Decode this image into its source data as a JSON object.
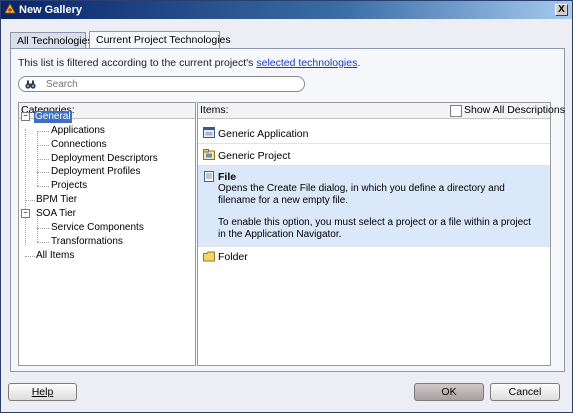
{
  "window": {
    "title": "New Gallery",
    "close_label": "X"
  },
  "tabs": [
    {
      "label": "All Technologies",
      "active": false
    },
    {
      "label": "Current Project Technologies",
      "active": true
    }
  ],
  "filter": {
    "text": "This list is filtered according to the current project's",
    "link": "selected technologies",
    "suffix": "."
  },
  "search": {
    "placeholder": "Search"
  },
  "categories": {
    "header": "Categories:",
    "tree": [
      {
        "label": "General",
        "selected": true,
        "expanded": true
      },
      {
        "label": "Applications"
      },
      {
        "label": "Connections"
      },
      {
        "label": "Deployment Descriptors"
      },
      {
        "label": "Deployment Profiles"
      },
      {
        "label": "Projects"
      },
      {
        "label": "BPM Tier"
      },
      {
        "label": "SOA Tier",
        "expanded": true
      },
      {
        "label": "Service Components"
      },
      {
        "label": "Transformations"
      },
      {
        "label": "All Items"
      }
    ]
  },
  "items": {
    "header": "Items:",
    "show_all_descriptions": "Show All Descriptions",
    "list": [
      {
        "label": "Generic Application",
        "icon": "application-icon"
      },
      {
        "label": "Generic Project",
        "icon": "project-icon"
      },
      {
        "label": "File",
        "icon": "file-icon",
        "selected": true,
        "description": "Opens the Create File dialog, in which you define a directory and filename for a new empty file.",
        "note": "To enable this option, you must select a project or a file within a project in the Application Navigator."
      },
      {
        "label": "Folder",
        "icon": "folder-icon"
      }
    ]
  },
  "buttons": {
    "help": "Help",
    "ok": "OK",
    "cancel": "Cancel"
  },
  "colors": {
    "title_bar": "#0a246a",
    "selection": "#3f6fc2",
    "selected_item_bg": "#dae8fa",
    "link": "#1a3ac8"
  }
}
